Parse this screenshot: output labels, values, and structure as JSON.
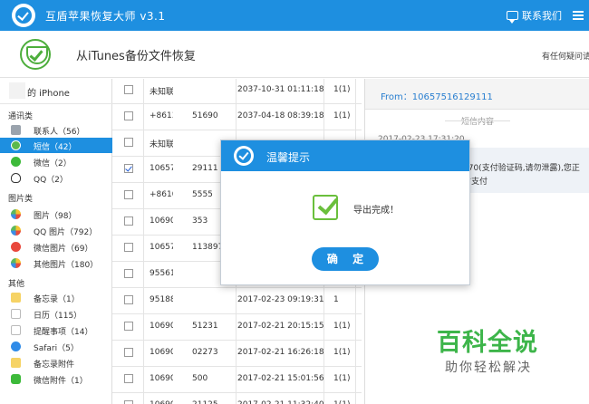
{
  "app": {
    "title": "互盾苹果恢复大师 v3.1",
    "contact": "联系我们"
  },
  "header": {
    "title": "从iTunes备份文件恢复",
    "help_link": "有任何疑问请"
  },
  "sidebar": {
    "device_name": "的 iPhone",
    "categories": [
      {
        "label": "通讯类",
        "items": [
          {
            "label": "联系人（56）",
            "icon": "contacts-icon"
          },
          {
            "label": "短信（42）",
            "icon": "sms-icon",
            "active": true
          },
          {
            "label": "微信（2）",
            "icon": "wechat-icon"
          },
          {
            "label": "QQ（2）",
            "icon": "qq-icon"
          }
        ]
      },
      {
        "label": "图片类",
        "items": [
          {
            "label": "图片（98）",
            "icon": "photos-icon"
          },
          {
            "label": "QQ 图片（792）",
            "icon": "qq-photos-icon"
          },
          {
            "label": "微信图片（69）",
            "icon": "wechat-photos-icon"
          },
          {
            "label": "其他图片（180）",
            "icon": "other-photos-icon"
          }
        ]
      },
      {
        "label": "其他",
        "items": [
          {
            "label": "备忘录（1）",
            "icon": "notes-icon"
          },
          {
            "label": "日历（115）",
            "icon": "calendar-icon"
          },
          {
            "label": "提醒事项（14）",
            "icon": "reminders-icon"
          },
          {
            "label": "Safari（5）",
            "icon": "safari-icon"
          },
          {
            "label": "备忘录附件",
            "icon": "notes-attachment-icon"
          },
          {
            "label": "微信附件（1）",
            "icon": "wechat-attachment-icon"
          }
        ]
      }
    ]
  },
  "table": {
    "rows": [
      {
        "checked": false,
        "num": "未知联",
        "num2": "",
        "date": "2037-10-31 01:11:18",
        "count": "1(1)"
      },
      {
        "checked": false,
        "num": "+8613",
        "num2": "51690",
        "date": "2037-04-18 08:39:18",
        "count": "1(1)"
      },
      {
        "checked": false,
        "num": "未知联",
        "num2": "",
        "date": "",
        "count": ""
      },
      {
        "checked": true,
        "num": "10657",
        "num2": "29111",
        "date": "",
        "count": ""
      },
      {
        "checked": false,
        "num": "+8610",
        "num2": "5555",
        "date": "",
        "count": ""
      },
      {
        "checked": false,
        "num": "10690",
        "num2": "353",
        "date": "",
        "count": ""
      },
      {
        "checked": false,
        "num": "10657",
        "num2": "1138975",
        "date": "",
        "count": ""
      },
      {
        "checked": false,
        "num": "95561",
        "num2": "",
        "date": "",
        "count": ""
      },
      {
        "checked": false,
        "num": "95188",
        "num2": "",
        "date": "2017-02-23 09:19:31",
        "count": "1"
      },
      {
        "checked": false,
        "num": "10690",
        "num2": "51231",
        "date": "2017-02-21 20:15:15",
        "count": "1(1)"
      },
      {
        "checked": false,
        "num": "10690",
        "num2": "02273",
        "date": "2017-02-21 16:26:18",
        "count": "1(1)"
      },
      {
        "checked": false,
        "num": "10690",
        "num2": "500",
        "date": "2017-02-21 15:01:56",
        "count": "1(1)"
      },
      {
        "checked": false,
        "num": "10690",
        "num2": "21125",
        "date": "2017-02-21 11:32:40",
        "count": "1(1)"
      }
    ]
  },
  "detail": {
    "from": "From：10657516129111",
    "section_label": "短信内容",
    "time": "2017-02-23 17:31:20",
    "message_line1": "370(支付验证码,请勿泄露),您正",
    "message_line2": "信支付"
  },
  "dialog": {
    "title": "温馨提示",
    "message": "导出完成！",
    "ok_label": "确 定"
  },
  "watermark": {
    "line1": "百科全说",
    "line2": "助你轻松解决"
  },
  "colors": {
    "accent": "#1e8fe0",
    "success": "#6abf3c",
    "link": "#2a7fd0"
  }
}
